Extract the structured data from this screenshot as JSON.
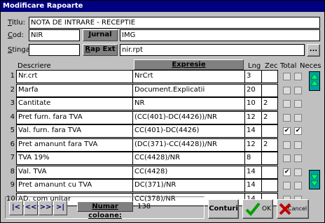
{
  "window": {
    "title": "Modificare Rapoarte"
  },
  "form": {
    "titlu_label": "Titlu:",
    "titlu_value": "NOTA DE INTRARE - RECEPTIE",
    "cod_label": "Cod:",
    "cod_value": "NIR",
    "jurnal_button": "Jurnal",
    "jurnal_value": "IMG",
    "stinga_label": "Stinga",
    "stinga_value": "",
    "rap_ext_button": "Rap Ext",
    "rap_ext_value": "nir.rpt",
    "browse_button": "..."
  },
  "grid": {
    "headers": {
      "descriere": "Descriere",
      "expresie": "Expresie",
      "lng": "Lng",
      "zec": "Zec",
      "total": "Total",
      "neces": "Neces"
    },
    "rows": [
      {
        "num": "1",
        "descriere": "Nr.crt",
        "expresie": "NrCrt",
        "lng": "3",
        "zec": "",
        "total": false,
        "neces": false
      },
      {
        "num": "2",
        "descriere": "Marfa",
        "expresie": "Document.Explicatii",
        "lng": "20",
        "zec": "",
        "total": false,
        "neces": false
      },
      {
        "num": "3",
        "descriere": "Cantitate",
        "expresie": "NR",
        "lng": "10",
        "zec": "2",
        "total": false,
        "neces": false
      },
      {
        "num": "4",
        "descriere": "Pret furn. fara TVA",
        "expresie": "(CC(401)-DC(4426))/NR",
        "lng": "12",
        "zec": "2",
        "total": false,
        "neces": false
      },
      {
        "num": "5",
        "descriere": "Val. furn. fara TVA",
        "expresie": "CC(401)-DC(4426)",
        "lng": "14",
        "zec": "",
        "total": true,
        "neces": true
      },
      {
        "num": "6",
        "descriere": "Pret amanunt fara TVA",
        "expresie": "(DC(371)-CC(4428))/NR",
        "lng": "12",
        "zec": "2",
        "total": false,
        "neces": false
      },
      {
        "num": "7",
        "descriere": "TVA 19%",
        "expresie": "CC(4428)/NR",
        "lng": "8",
        "zec": "",
        "total": false,
        "neces": false
      },
      {
        "num": "8",
        "descriere": "Val. TVA",
        "expresie": "CC(4428)",
        "lng": "14",
        "zec": "",
        "total": true,
        "neces": false
      },
      {
        "num": "9",
        "descriere": "Pret amanunt cu TVA",
        "expresie": "DC(371)/NR",
        "lng": "14",
        "zec": "",
        "total": false,
        "neces": false
      },
      {
        "num": "10",
        "descriere": "AD. com unitar",
        "expresie": "CC(378)/NR",
        "lng": "14",
        "zec": "",
        "total": false,
        "neces": false
      }
    ]
  },
  "footer": {
    "numar_coloane_label": "Numar coloane:",
    "numar_coloane_value": "138",
    "conturi_button": "Conturi",
    "ok_button": "OK",
    "cancel_button": "Cancel",
    "nav": [
      "|<",
      "<<",
      ">>",
      ">|"
    ]
  },
  "colors": {
    "titlebar": "#000080",
    "accent_green": "#00a000",
    "cancel_red": "#c00000",
    "scroll_teal": "#00a0a0"
  }
}
